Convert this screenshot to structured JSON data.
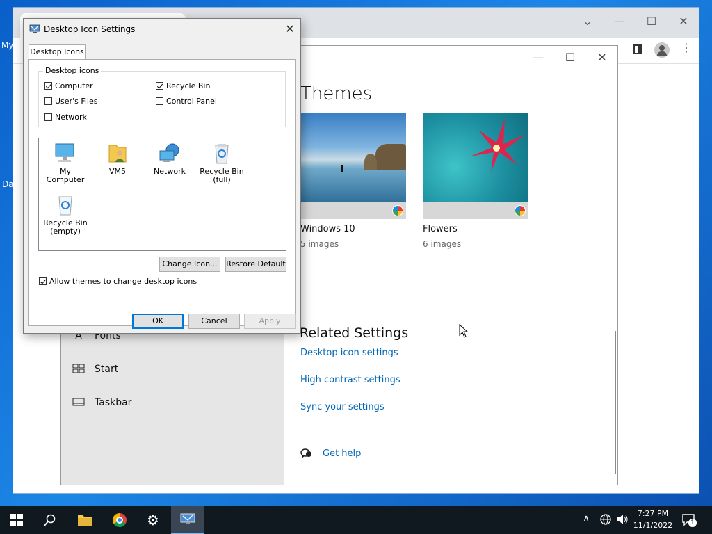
{
  "desktop": {
    "fragments": [
      "My",
      "Da"
    ]
  },
  "settings": {
    "nav": {
      "fonts": "Fonts",
      "start": "Start",
      "taskbar": "Taskbar"
    },
    "themes_title": "Themes",
    "themes": [
      {
        "name": "Windows 10",
        "count": "5 images"
      },
      {
        "name": "Flowers",
        "count": "6 images"
      }
    ],
    "related_title": "Related Settings",
    "links": {
      "desktop_icon": "Desktop icon settings",
      "high_contrast": "High contrast settings",
      "sync": "Sync your settings",
      "help": "Get help"
    }
  },
  "dialog": {
    "title": "Desktop Icon Settings",
    "tab": "Desktop Icons",
    "group_label": "Desktop icons",
    "checkboxes": {
      "computer": {
        "label": "Computer",
        "checked": true
      },
      "recycle_bin": {
        "label": "Recycle Bin",
        "checked": true
      },
      "users_files": {
        "label": "User's Files",
        "checked": false
      },
      "control_panel": {
        "label": "Control Panel",
        "checked": false
      },
      "network": {
        "label": "Network",
        "checked": false
      }
    },
    "icons": {
      "my_computer": "My Computer",
      "vm5": "VM5",
      "network": "Network",
      "recycle_full_1": "Recycle Bin",
      "recycle_full_2": "(full)",
      "recycle_empty_1": "Recycle Bin",
      "recycle_empty_2": "(empty)"
    },
    "change_icon": "Change Icon...",
    "restore_default": "Restore Default",
    "allow_themes": {
      "label": "Allow themes to change desktop icons",
      "checked": true
    },
    "ok": "OK",
    "cancel": "Cancel",
    "apply": "Apply"
  },
  "taskbar": {
    "time": "7:27 PM",
    "date": "11/1/2022",
    "notification_count": "1"
  },
  "colors": {
    "link": "#0067b8",
    "accent": "#0078d7"
  }
}
